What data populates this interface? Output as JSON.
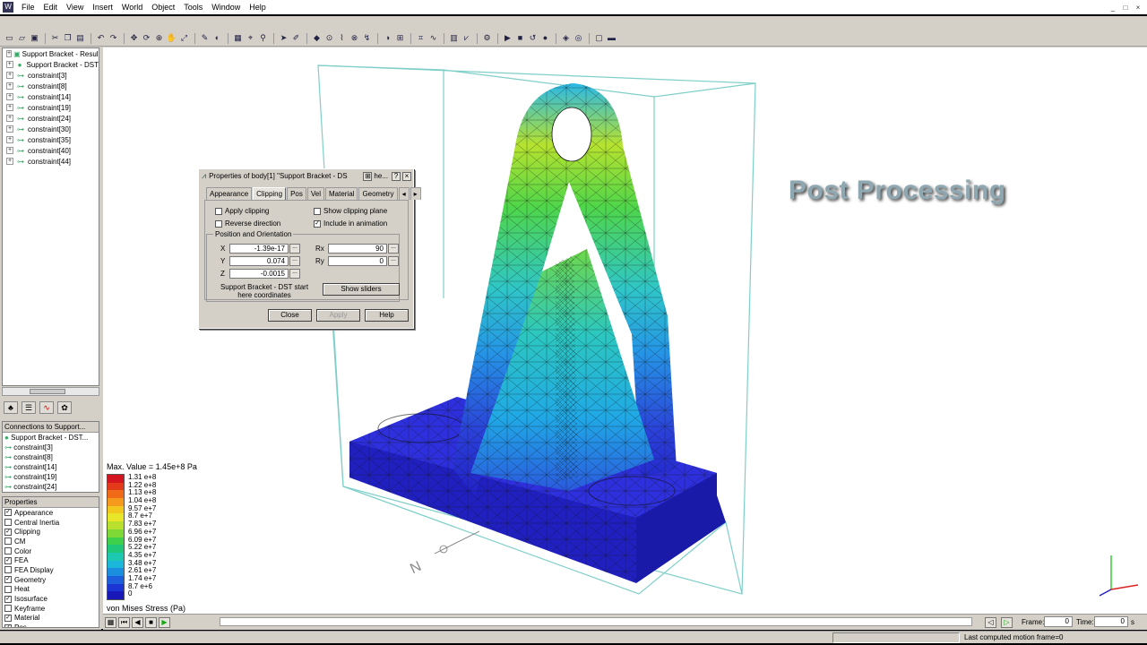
{
  "menu": [
    "File",
    "Edit",
    "View",
    "Insert",
    "World",
    "Object",
    "Tools",
    "Window",
    "Help"
  ],
  "window_buttons": [
    "_",
    "□",
    "×"
  ],
  "toolbar_icons": [
    "new-icon",
    "open-icon",
    "save-icon",
    "sep",
    "cut-icon",
    "copy-icon",
    "paste-icon",
    "sep",
    "undo-icon",
    "redo-icon",
    "sep",
    "move-icon",
    "rotate-icon",
    "zoom-icon",
    "pan-icon",
    "fit-icon",
    "sep",
    "sketch-icon",
    "render-icon",
    "sep",
    "grid-icon",
    "snap-icon",
    "connect-icon",
    "sep",
    "select-icon",
    "edit-icon",
    "sep",
    "body-icon",
    "joint-icon",
    "spring-icon",
    "motor-icon",
    "force-icon",
    "sep",
    "color-icon",
    "mesh-icon",
    "sep",
    "measure-icon",
    "trace-icon",
    "sep",
    "meter-icon",
    "plot-icon",
    "sep",
    "settings-icon",
    "sep",
    "run-icon",
    "stop-icon",
    "reset-icon",
    "record-icon",
    "sep",
    "fea-icon",
    "stress-icon",
    "sep",
    "display-icon",
    "window-icon"
  ],
  "tree": {
    "items": [
      {
        "label": "Support Bracket - Results",
        "type": "root"
      },
      {
        "label": "Support Bracket - DST",
        "type": "body"
      },
      {
        "label": "constraint[3]",
        "type": "constraint"
      },
      {
        "label": "constraint[8]",
        "type": "constraint"
      },
      {
        "label": "constraint[14]",
        "type": "constraint"
      },
      {
        "label": "constraint[19]",
        "type": "constraint"
      },
      {
        "label": "constraint[24]",
        "type": "constraint"
      },
      {
        "label": "constraint[30]",
        "type": "constraint"
      },
      {
        "label": "constraint[35]",
        "type": "constraint"
      },
      {
        "label": "constraint[40]",
        "type": "constraint"
      },
      {
        "label": "constraint[44]",
        "type": "constraint"
      }
    ]
  },
  "connections": {
    "header": "Connections to Support...",
    "items": [
      "Support Bracket - DST...",
      "constraint[3]",
      "constraint[8]",
      "constraint[14]",
      "constraint[19]",
      "constraint[24]"
    ]
  },
  "properties": {
    "header": "Properties",
    "items": [
      {
        "label": "Appearance",
        "checked": true
      },
      {
        "label": "Central Inertia",
        "checked": false
      },
      {
        "label": "Clipping",
        "checked": true
      },
      {
        "label": "CM",
        "checked": false
      },
      {
        "label": "Color",
        "checked": false
      },
      {
        "label": "FEA",
        "checked": true
      },
      {
        "label": "FEA Display",
        "checked": false
      },
      {
        "label": "Geometry",
        "checked": true
      },
      {
        "label": "Heat",
        "checked": false
      },
      {
        "label": "Isosurface",
        "checked": true
      },
      {
        "label": "Keyframe",
        "checked": false
      },
      {
        "label": "Material",
        "checked": true
      },
      {
        "label": "Pos",
        "checked": true
      }
    ]
  },
  "legend": {
    "max_value": "Max. Value = 1.45e+8 Pa",
    "unit": "von Mises Stress  (Pa)",
    "entries": [
      {
        "value": "1.31  e+8",
        "color": "#d4141e"
      },
      {
        "value": "1.22  e+8",
        "color": "#e33a1a"
      },
      {
        "value": "1.13  e+8",
        "color": "#f06a18"
      },
      {
        "value": "1.04  e+8",
        "color": "#f59a1c"
      },
      {
        "value": "9.57  e+7",
        "color": "#f2c81e"
      },
      {
        "value": "8.7    e+7",
        "color": "#e8e628"
      },
      {
        "value": "7.83  e+7",
        "color": "#b8e02c"
      },
      {
        "value": "6.96  e+7",
        "color": "#7ed836"
      },
      {
        "value": "6.09  e+7",
        "color": "#3ed04a"
      },
      {
        "value": "5.22  e+7",
        "color": "#1ec878"
      },
      {
        "value": "4.35  e+7",
        "color": "#1cc8b0"
      },
      {
        "value": "3.48  e+7",
        "color": "#1cb8dc"
      },
      {
        "value": "2.61  e+7",
        "color": "#1c8ee0"
      },
      {
        "value": "1.74  e+7",
        "color": "#1c5edc"
      },
      {
        "value": "8.7    e+6",
        "color": "#1c34d4"
      },
      {
        "value": "0",
        "color": "#1818b8"
      }
    ]
  },
  "overlay_title": "Post Processing",
  "dialog": {
    "title": "Properties of body[1] \"Support Bracket - DS",
    "title_extra": "he...",
    "tabs": [
      "Appearance",
      "Clipping",
      "Pos",
      "Vel",
      "Material",
      "Geometry"
    ],
    "active_tab": "Clipping",
    "checks": [
      {
        "label": "Apply clipping",
        "checked": false
      },
      {
        "label": "Show clipping plane",
        "checked": false
      },
      {
        "label": "Reverse direction",
        "checked": false
      },
      {
        "label": "Include in animation",
        "checked": true
      }
    ],
    "group_label": "Position and Orientation",
    "fields": {
      "x_label": "X",
      "x": "-1.39e-17",
      "y_label": "Y",
      "y": "0.074",
      "z_label": "Z",
      "z": "-0.0015",
      "rx_label": "Rx",
      "rx": "90",
      "ry_label": "Ry",
      "ry": "0"
    },
    "dots": "...",
    "coord_note": "Support Bracket - DST start here coordinates",
    "show_sliders": "Show sliders",
    "close": "Close",
    "apply": "Apply",
    "help": "Help"
  },
  "compass_label": "N",
  "timeline": {
    "frame_label": "Frame:",
    "frame_value": "0",
    "time_label": "Time:",
    "time_value": "0",
    "time_unit": "s"
  },
  "status": {
    "message": "Last computed motion frame=0"
  }
}
